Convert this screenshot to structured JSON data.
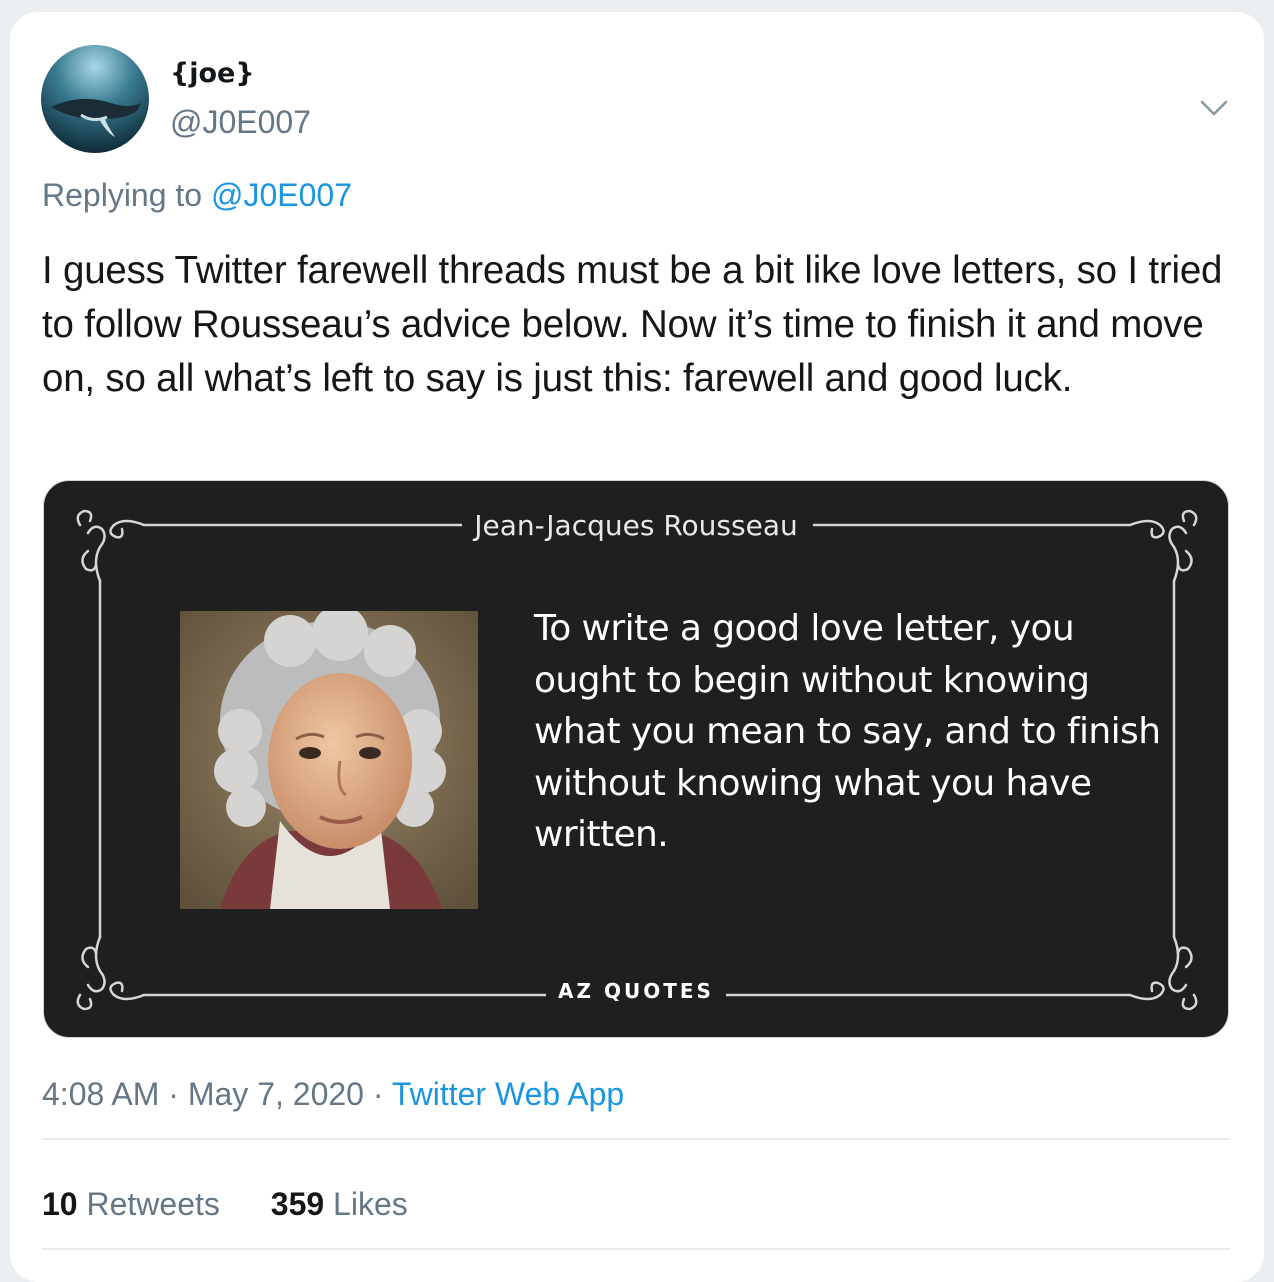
{
  "tweet": {
    "author": {
      "display_name": "{joe}",
      "handle": "@J0E007",
      "avatar_icon": "whale-avatar"
    },
    "menu_icon": "chevron-down-icon",
    "reply": {
      "prefix": "Replying to ",
      "mention": "@J0E007"
    },
    "text": "I guess Twitter farewell threads must be a bit like love letters, so I tried to follow Rousseau’s advice below. Now it’s time to finish it and move on, so all what’s left to say is just this: farewell and good luck.",
    "media": {
      "quote_author": "Jean-Jacques Rousseau",
      "quote_text": "To write a good love letter, you ought to begin without knowing what you mean to say, and to finish without knowing what you have written.",
      "brand": "AZ QUOTES"
    },
    "meta": {
      "time": "4:08 AM",
      "separator": " · ",
      "date": "May 7, 2020",
      "source": "Twitter Web App"
    },
    "stats": {
      "retweets_count": "10",
      "retweets_label": " Retweets",
      "likes_count": "359",
      "likes_label": " Likes"
    }
  },
  "colors": {
    "text_primary": "#14171a",
    "text_secondary": "#657786",
    "link": "#1b95e0",
    "media_background": "#1f1f1f"
  }
}
